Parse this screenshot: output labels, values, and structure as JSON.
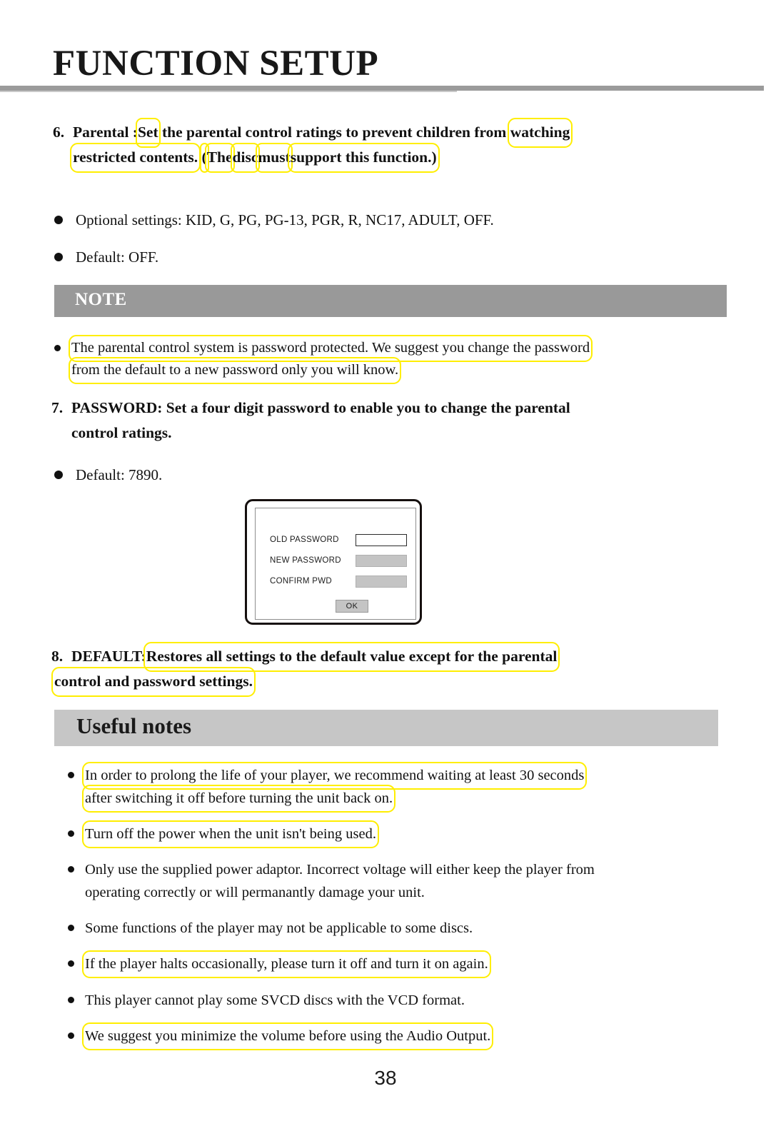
{
  "header": {
    "title": "FUNCTION SETUP"
  },
  "parental": {
    "number": "6.",
    "line1_pre": "Parental :",
    "line1_box_set": "Set",
    "line1_mid": "the parental control ratings to prevent children from",
    "line1_box_watching": "watching",
    "line2_box_restricted": "restricted contents.",
    "line2_box_paren": "(",
    "line2_box_the": "The",
    "line2_box_disc": "disc",
    "line2_box_must": "must",
    "line2_box_support": "support this function.)"
  },
  "top_bullets": [
    "Optional settings: KID, G, PG, PG-13, PGR, R, NC17, ADULT, OFF.",
    "Default: OFF."
  ],
  "note_section": {
    "bar_label": "NOTE",
    "bullet_line1": "The parental control system is password protected.  We suggest you change the password",
    "bullet_line2": "from the default to a new password only you will know."
  },
  "password_item": {
    "number": "7.",
    "line1": "PASSWORD: Set a four digit password to enable you to change the parental",
    "line2": "control ratings.",
    "default_bullet": "Default: 7890."
  },
  "password_dialog": {
    "rows": [
      {
        "label": "OLD PASSWORD",
        "field_state": "empty"
      },
      {
        "label": "NEW PASSWORD",
        "field_state": "filled"
      },
      {
        "label": "CONFIRM PWD",
        "field_state": "filled"
      }
    ],
    "ok_label": "OK"
  },
  "default_item": {
    "number": "8.",
    "line1_pre": "DEFAULT:",
    "line1_box": "Restores all settings to the default value except for the parental",
    "line2_box": "control and password settings."
  },
  "useful_notes": {
    "bar_label": "Useful notes",
    "items": [
      {
        "lines": [
          "In order to prolong the life of your player, we recommend waiting at least 30 seconds",
          "after switching it off before turning the unit back on."
        ],
        "highlighted": true
      },
      {
        "lines": [
          "Turn off the power when the unit isn't being used."
        ],
        "highlighted": true
      },
      {
        "lines": [
          "Only use the supplied power adaptor.  Incorrect voltage will either keep the player from",
          "operating correctly or will permanantly damage your unit."
        ],
        "highlighted": false
      },
      {
        "lines": [
          "Some functions of the player may not be applicable to some discs."
        ],
        "highlighted": false
      },
      {
        "lines": [
          "If the player halts occasionally, please turn it off and turn it on again."
        ],
        "highlighted": true
      },
      {
        "lines": [
          "This player cannot play some SVCD discs with the VCD format."
        ],
        "highlighted": false
      },
      {
        "lines": [
          "We suggest you minimize the volume before using the Audio Output."
        ],
        "highlighted": true
      }
    ]
  },
  "footer": {
    "page_number": "38"
  },
  "colors": {
    "note_bar": "#999999",
    "useful_bar": "#c6c6c6",
    "rule": "#9b9b9b",
    "annotation": "#ffee00"
  }
}
